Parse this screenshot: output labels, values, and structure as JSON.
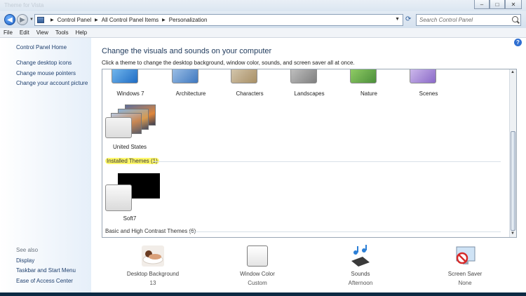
{
  "titlebar": {
    "ghost_text": "Theme for Vista",
    "controls": {
      "minimize": "–",
      "maximize": "□",
      "close": "✕"
    }
  },
  "address": {
    "crumbs": [
      "Control Panel",
      "All Control Panel Items",
      "Personalization"
    ],
    "search_placeholder": "Search Control Panel"
  },
  "menu": [
    "File",
    "Edit",
    "View",
    "Tools",
    "Help"
  ],
  "sidebar": {
    "home": "Control Panel Home",
    "links": [
      "Change desktop icons",
      "Change mouse pointers",
      "Change your account picture"
    ],
    "see_also_heading": "See also",
    "see_also": [
      "Display",
      "Taskbar and Start Menu",
      "Ease of Access Center"
    ]
  },
  "main": {
    "title": "Change the visuals and sounds on your computer",
    "subtitle": "Click a theme to change the desktop background, window color, sounds, and screen saver all at once.",
    "aero_themes": [
      "Windows 7",
      "Architecture",
      "Characters",
      "Landscapes",
      "Nature",
      "Scenes"
    ],
    "country_theme": "United States",
    "installed_heading": "Installed Themes (1)",
    "installed_theme": "Soft7",
    "basic_heading": "Basic and High Contrast Themes (6)"
  },
  "bottom": {
    "items": [
      {
        "name": "Desktop Background",
        "value": "13"
      },
      {
        "name": "Window Color",
        "value": "Custom"
      },
      {
        "name": "Sounds",
        "value": "Afternoon"
      },
      {
        "name": "Screen Saver",
        "value": "None"
      }
    ]
  },
  "colors": {
    "link": "#1e3f6e",
    "title": "#1e395b",
    "highlight": "#fff86a",
    "accent": "#2f6fd1"
  }
}
